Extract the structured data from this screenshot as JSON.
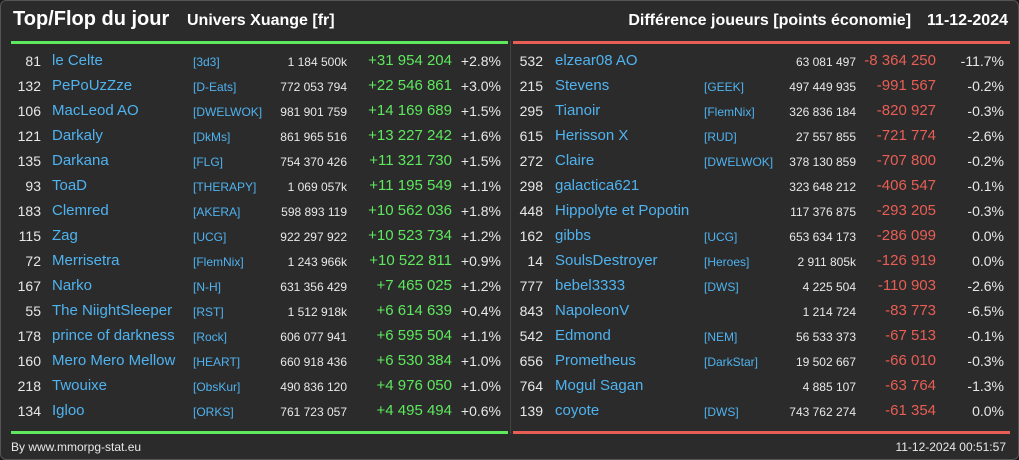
{
  "header": {
    "title": "Top/Flop du jour",
    "subtitle": "Univers Xuange [fr]",
    "right_title": "Différence joueurs [points économie]",
    "date": "11-12-2024"
  },
  "colors": {
    "positive": "#5ee85e",
    "negative": "#e85e54",
    "link": "#4fb3f0"
  },
  "top": [
    {
      "rank": "81",
      "name": "le Celte",
      "alliance": "[3d3]",
      "points": "1 184 500k",
      "diff": "+31 954 204",
      "pct": "+2.8%"
    },
    {
      "rank": "132",
      "name": "PePoUzZze",
      "alliance": "[D-Eats]",
      "points": "772 053 794",
      "diff": "+22 546 861",
      "pct": "+3.0%"
    },
    {
      "rank": "106",
      "name": "MacLeod AO",
      "alliance": "[DWELWOK]",
      "points": "981 901 759",
      "diff": "+14 169 689",
      "pct": "+1.5%"
    },
    {
      "rank": "121",
      "name": "Darkaly",
      "alliance": "[DkMs]",
      "points": "861 965 516",
      "diff": "+13 227 242",
      "pct": "+1.6%"
    },
    {
      "rank": "135",
      "name": "Darkana",
      "alliance": "[FLG]",
      "points": "754 370 426",
      "diff": "+11 321 730",
      "pct": "+1.5%"
    },
    {
      "rank": "93",
      "name": "ToaD",
      "alliance": "[THERAPY]",
      "points": "1 069 057k",
      "diff": "+11 195 549",
      "pct": "+1.1%"
    },
    {
      "rank": "183",
      "name": "Clemred",
      "alliance": "[AKERA]",
      "points": "598 893 119",
      "diff": "+10 562 036",
      "pct": "+1.8%"
    },
    {
      "rank": "115",
      "name": "Zag",
      "alliance": "[UCG]",
      "points": "922 297 922",
      "diff": "+10 523 734",
      "pct": "+1.2%"
    },
    {
      "rank": "72",
      "name": "Merrisetra",
      "alliance": "[FlemNix]",
      "points": "1 243 966k",
      "diff": "+10 522 811",
      "pct": "+0.9%"
    },
    {
      "rank": "167",
      "name": "Narko",
      "alliance": "[N-H]",
      "points": "631 356 429",
      "diff": "+7 465 025",
      "pct": "+1.2%"
    },
    {
      "rank": "55",
      "name": "The NiightSleeper",
      "alliance": "[RST]",
      "points": "1 512 918k",
      "diff": "+6 614 639",
      "pct": "+0.4%"
    },
    {
      "rank": "178",
      "name": "prince of darkness",
      "alliance": "[Rock]",
      "points": "606 077 941",
      "diff": "+6 595 504",
      "pct": "+1.1%"
    },
    {
      "rank": "160",
      "name": "Mero Mero Mellow",
      "alliance": "[HEART]",
      "points": "660 918 436",
      "diff": "+6 530 384",
      "pct": "+1.0%"
    },
    {
      "rank": "218",
      "name": "Twouixe",
      "alliance": "[ObsKur]",
      "points": "490 836 120",
      "diff": "+4 976 050",
      "pct": "+1.0%"
    },
    {
      "rank": "134",
      "name": "Igloo",
      "alliance": "[ORKS]",
      "points": "761 723 057",
      "diff": "+4 495 494",
      "pct": "+0.6%"
    }
  ],
  "flop": [
    {
      "rank": "532",
      "name": "elzear08 AO",
      "alliance": "",
      "points": "63 081 497",
      "diff": "-8 364 250",
      "pct": "-11.7%"
    },
    {
      "rank": "215",
      "name": "Stevens",
      "alliance": "[GEEK]",
      "points": "497 449 935",
      "diff": "-991 567",
      "pct": "-0.2%"
    },
    {
      "rank": "295",
      "name": "Tianoir",
      "alliance": "[FlemNix]",
      "points": "326 836 184",
      "diff": "-820 927",
      "pct": "-0.3%"
    },
    {
      "rank": "615",
      "name": "Herisson X",
      "alliance": "[RUD]",
      "points": "27 557 855",
      "diff": "-721 774",
      "pct": "-2.6%"
    },
    {
      "rank": "272",
      "name": "Claire",
      "alliance": "[DWELWOK]",
      "points": "378 130 859",
      "diff": "-707 800",
      "pct": "-0.2%"
    },
    {
      "rank": "298",
      "name": "galactica621",
      "alliance": "",
      "points": "323 648 212",
      "diff": "-406 547",
      "pct": "-0.1%"
    },
    {
      "rank": "448",
      "name": "Hippolyte et Popotin",
      "alliance": "",
      "points": "117 376 875",
      "diff": "-293 205",
      "pct": "-0.3%"
    },
    {
      "rank": "162",
      "name": "gibbs",
      "alliance": "[UCG]",
      "points": "653 634 173",
      "diff": "-286 099",
      "pct": "0.0%"
    },
    {
      "rank": "14",
      "name": "SoulsDestroyer",
      "alliance": "[Heroes]",
      "points": "2 911 805k",
      "diff": "-126 919",
      "pct": "0.0%"
    },
    {
      "rank": "777",
      "name": "bebel3333",
      "alliance": "[DWS]",
      "points": "4 225 504",
      "diff": "-110 903",
      "pct": "-2.6%"
    },
    {
      "rank": "843",
      "name": "NapoleonV",
      "alliance": "",
      "points": "1 214 724",
      "diff": "-83 773",
      "pct": "-6.5%"
    },
    {
      "rank": "542",
      "name": "Edmond",
      "alliance": "[NEM]",
      "points": "56 533 373",
      "diff": "-67 513",
      "pct": "-0.1%"
    },
    {
      "rank": "656",
      "name": "Prometheus",
      "alliance": "[DarkStar]",
      "points": "19 502 667",
      "diff": "-66 010",
      "pct": "-0.3%"
    },
    {
      "rank": "764",
      "name": "Mogul Sagan",
      "alliance": "",
      "points": "4 885 107",
      "diff": "-63 764",
      "pct": "-1.3%"
    },
    {
      "rank": "139",
      "name": "coyote",
      "alliance": "[DWS]",
      "points": "743 762 274",
      "diff": "-61 354",
      "pct": "0.0%"
    }
  ],
  "footer": {
    "credit": "By www.mmorpg-stat.eu",
    "timestamp": "11-12-2024 00:51:57"
  }
}
